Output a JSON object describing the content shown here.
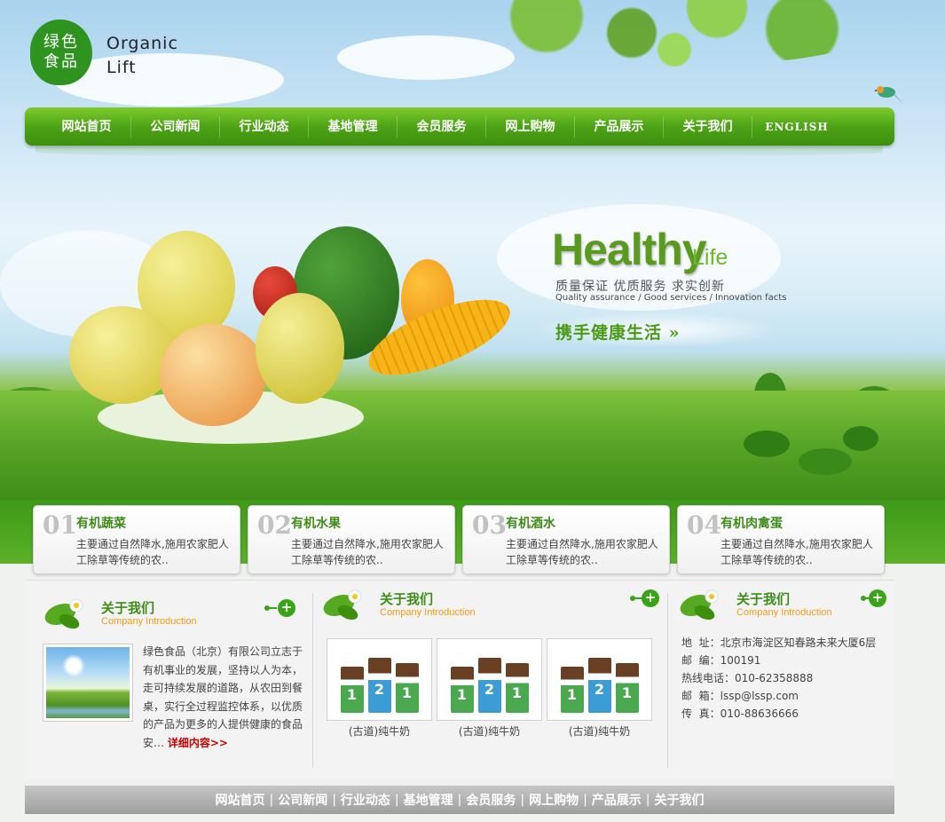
{
  "brand": {
    "logo_text": "绿色\n食品",
    "name_line1": "Organic",
    "name_line2": "Lift"
  },
  "nav": {
    "items": [
      "网站首页",
      "公司新闻",
      "行业动态",
      "基地管理",
      "会员服务",
      "网上购物",
      "产品展示",
      "关于我们",
      "ENGLISH"
    ]
  },
  "banner": {
    "headline": "Healthy",
    "headline_sub": "Life",
    "tagline_cn": "质量保证 优质服务 求实创新",
    "tagline_en": "Quality assurance / Good services / Innovation facts",
    "slogan": "携手健康生活 »"
  },
  "features": [
    {
      "num": "01",
      "title": "有机蔬菜",
      "desc": "主要通过自然降水,施用农家肥人工除草等传统的农.."
    },
    {
      "num": "02",
      "title": "有机水果",
      "desc": "主要通过自然降水,施用农家肥人工除草等传统的农.."
    },
    {
      "num": "03",
      "title": "有机酒水",
      "desc": "主要通过自然降水,施用农家肥人工除草等传统的农.."
    },
    {
      "num": "04",
      "title": "有机肉禽蛋",
      "desc": "主要通过自然降水,施用农家肥人工除草等传统的农.."
    }
  ],
  "sections": [
    {
      "title": "关于我们",
      "subtitle": "Company Introduction"
    },
    {
      "title": "关于我们",
      "subtitle": "Company Introduction"
    },
    {
      "title": "关于我们",
      "subtitle": "Company Introduction"
    }
  ],
  "about": {
    "text": "绿色食品（北京）有限公司立志于有机事业的发展，坚持以人为本，走可持续发展的道路，从农田到餐桌，实行全过程监控体系，以优质的产品为更多的人提供健康的食品安…",
    "more": "详细内容>>"
  },
  "products": [
    {
      "name": "(古道)纯牛奶"
    },
    {
      "name": "(古道)纯牛奶"
    },
    {
      "name": "(古道)纯牛奶"
    }
  ],
  "contact": {
    "address": "地  址：北京市海淀区知春路未来大厦6层",
    "zip": "邮  编：100191",
    "hotline": "热线电话：010-62358888",
    "email": "邮  箱：lssp@lssp.com",
    "fax": "传  真：010-88636666"
  },
  "footer": {
    "links": [
      "网站首页",
      "公司新闻",
      "行业动态",
      "基地管理",
      "会员服务",
      "网上购物",
      "产品展示",
      "关于我们"
    ]
  },
  "colors": {
    "brand_green": "#3e8f0e",
    "accent_orange": "#f39c12",
    "link_red": "#c40000"
  }
}
